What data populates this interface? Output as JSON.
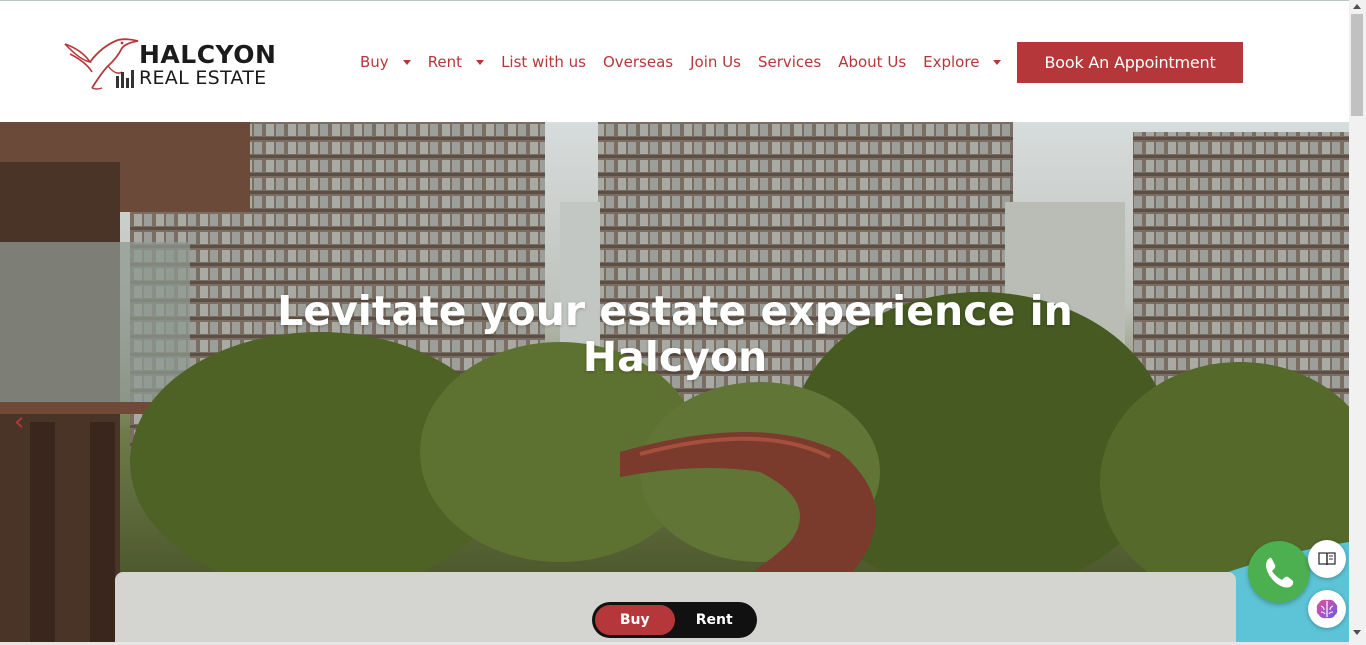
{
  "brand": {
    "name_line1": "HALCYON",
    "name_line2": "REAL ESTATE"
  },
  "nav": {
    "items": [
      {
        "label": "Buy",
        "has_dropdown": true
      },
      {
        "label": "Rent",
        "has_dropdown": true
      },
      {
        "label": "List with us",
        "has_dropdown": false
      },
      {
        "label": "Overseas",
        "has_dropdown": false
      },
      {
        "label": "Join Us",
        "has_dropdown": false
      },
      {
        "label": "Services",
        "has_dropdown": false
      },
      {
        "label": "About Us",
        "has_dropdown": false
      },
      {
        "label": "Explore",
        "has_dropdown": true
      }
    ],
    "cta_label": "Book An Appointment"
  },
  "hero": {
    "title_line1": "Levitate your estate experience in",
    "title_line2": "Halcyon",
    "prev_arrow": "‹"
  },
  "search": {
    "toggle": {
      "options": [
        "Buy",
        "Rent"
      ],
      "selected": "Buy"
    }
  },
  "floating": {
    "whatsapp_icon": "whatsapp-icon",
    "reader_icon": "book-reader-icon",
    "brain_icon": "brain-icon"
  },
  "colors": {
    "accent": "#b6373a",
    "toggle_bg": "#111111",
    "panel_bg": "#d4d4d0",
    "whatsapp": "#4caf50"
  }
}
